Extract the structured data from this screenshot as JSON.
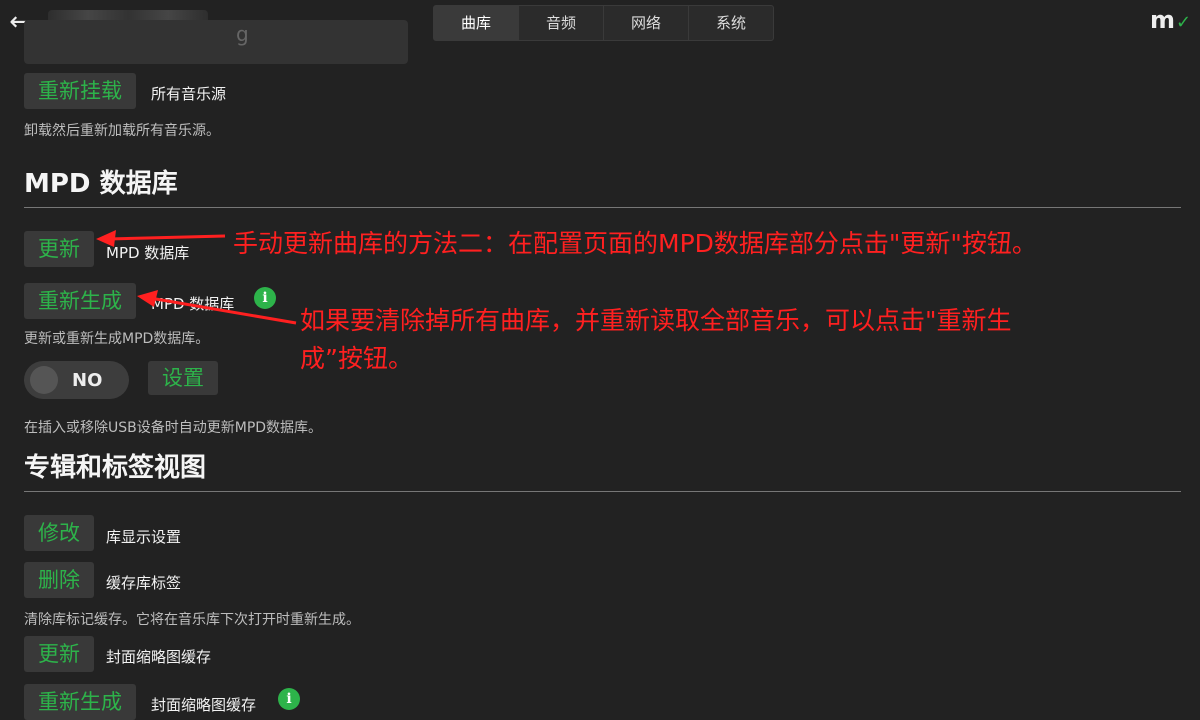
{
  "header": {
    "tabs": [
      {
        "label": "曲库",
        "active": true
      },
      {
        "label": "音频",
        "active": false
      },
      {
        "label": "网络",
        "active": false
      },
      {
        "label": "系统",
        "active": false
      }
    ],
    "logo": "m"
  },
  "remount": {
    "button": "重新挂载",
    "label": "所有音乐源",
    "desc": "卸载然后重新加载所有音乐源。"
  },
  "mpd": {
    "heading": "MPD 数据库",
    "update_button": "更新",
    "update_label": "MPD 数据库",
    "rebuild_button": "重新生成",
    "rebuild_label": "MPD 数据库",
    "desc": "更新或重新生成MPD数据库。",
    "toggle_value": "NO",
    "settings_button": "设置",
    "usb_desc": "在插入或移除USB设备时自动更新MPD数据库。"
  },
  "album_tag": {
    "heading": "专辑和标签视图",
    "edit_button": "修改",
    "edit_label": "库显示设置",
    "delete_button": "删除",
    "delete_label": "缓存库标签",
    "delete_desc": "清除库标记缓存。它将在音乐库下次打开时重新生成。",
    "thumb_update_button": "更新",
    "thumb_update_label": "封面缩略图缓存",
    "thumb_rebuild_button": "重新生成",
    "thumb_rebuild_label": "封面缩略图缓存"
  },
  "annotations": {
    "note1": "手动更新曲库的方法二：在配置页面的MPD数据库部分点击\"更新\"按钮。",
    "note2_line1": "如果要清除掉所有曲库，并重新读取全部音乐，可以点击\"重新生",
    "note2_line2": "成”按钮。"
  },
  "colors": {
    "accent": "#2db34a",
    "annotation": "#ff2020",
    "background": "#222222"
  }
}
